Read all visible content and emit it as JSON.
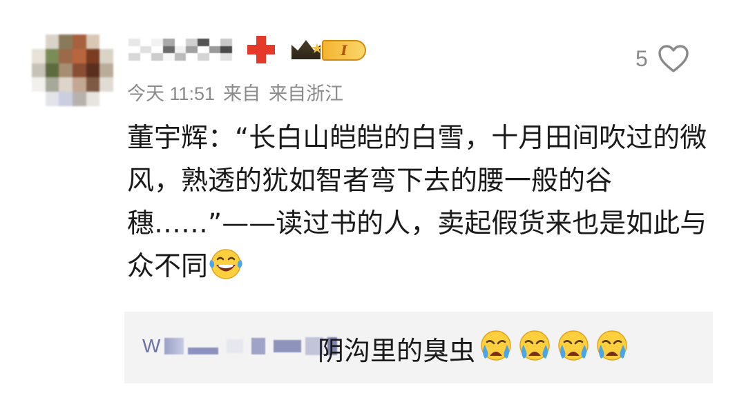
{
  "comment": {
    "time": "今天 11:51",
    "from_label": "来自",
    "location": "来自浙江",
    "like_count": "5",
    "text": "董宇辉：“长白山皑皑的白雪，十月田间吹过的微风，熟透的犹如智者弯下去的腰一般的谷穗……”——读过书的人，卖起假货来也是如此与众不同",
    "badge_level": "I"
  },
  "reply": {
    "name_initial": "W",
    "text": "阴沟里的臭虫"
  },
  "icons": {
    "like": "heart-outline-icon",
    "laugh": "laughing-tears-emoji",
    "cry": "crying-emoji",
    "vip": "crown-badge-icon",
    "medical": "red-cross-badge-icon"
  },
  "colors": {
    "meta_gray": "#8a8a8a",
    "text": "#1a1a1a",
    "reply_bg": "#f3f3f3",
    "link_blue": "#6a72a8",
    "red_badge": "#e53a2a",
    "gold_badge": "#f4b430"
  }
}
